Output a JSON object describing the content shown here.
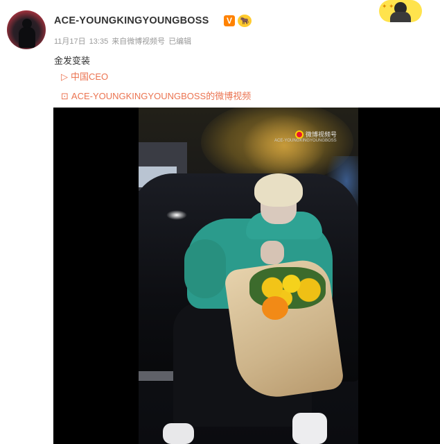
{
  "post": {
    "username": "ACE-YOUNGKINGYOUNGBOSS",
    "verified_badge": "V",
    "fan_badge": "🐂",
    "meta": {
      "date": "11月17日",
      "time": "13:35",
      "source_prefix": "来自",
      "source": "微博视频号",
      "edited": "已编辑"
    },
    "text": "金发变装",
    "links": [
      {
        "icon": "play-icon",
        "glyph": "▷",
        "label": "中国CEO"
      },
      {
        "icon": "video-icon",
        "glyph": "⊡",
        "label": "ACE-YOUNGKINGYOUNGBOSS的微博视频"
      }
    ],
    "video": {
      "watermark_title": "微博视频号",
      "watermark_sub": "ACE-YOUNGKINGYOUNGBOSS"
    }
  },
  "colors": {
    "link": "#eb7350",
    "badge": "#ff8200",
    "text": "#333333",
    "meta": "#999999"
  }
}
